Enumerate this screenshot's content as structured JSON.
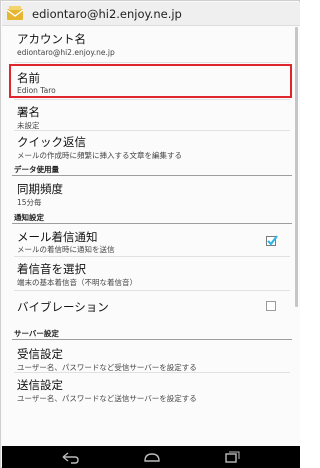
{
  "actionbar": {
    "title": "ediontaro@hi2.enjoy.ne.jp",
    "icon": "mail-app-icon"
  },
  "settings": {
    "account_name": {
      "title": "アカウント名",
      "summary": "ediontaro@hi2.enjoy.ne.jp"
    },
    "name": {
      "title": "名前",
      "summary": "Edion Taro"
    },
    "signature": {
      "title": "署名",
      "summary": "未設定"
    },
    "quick_reply": {
      "title": "クイック返信",
      "summary": "メールの作成時に頻繁に挿入する文章を編集する"
    },
    "data_usage_header": "データ使用量",
    "sync_frequency": {
      "title": "同期頻度",
      "summary": "15分毎"
    },
    "notification_header": "通知設定",
    "mail_notification": {
      "title": "メール着信通知",
      "summary": "メールの着信時に通知を送信",
      "checked": true
    },
    "ringtone": {
      "title": "着信音を選択",
      "summary": "端末の基本着信音（不明な着信音）"
    },
    "vibration": {
      "title": "バイブレーション",
      "checked": false
    },
    "server_header": "サーバー設定",
    "incoming": {
      "title": "受信設定",
      "summary": "ユーザー名、パスワードなど受信サーバーを設定する"
    },
    "outgoing": {
      "title": "送信設定",
      "summary": "ユーザー名、パスワードなど送信サーバーを設定する"
    }
  },
  "navbar": {
    "back": "back-icon",
    "home": "home-icon",
    "recents": "recents-icon"
  },
  "colors": {
    "highlight": "#e0262d",
    "checkbox_accent": "#33b5e5"
  }
}
